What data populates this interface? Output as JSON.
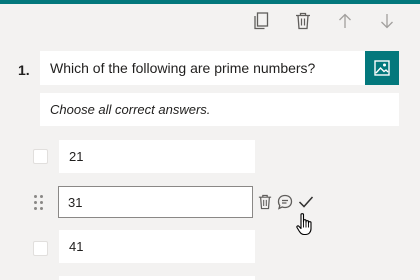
{
  "colors": {
    "accent": "#03787c",
    "icon": "#605e5c",
    "icon_disabled": "#a19f9d"
  },
  "toolbar": {
    "icons": [
      "copy-icon",
      "delete-icon",
      "move-up-icon",
      "move-down-icon"
    ]
  },
  "question": {
    "number": "1.",
    "title": "Which of the following are prime numbers?",
    "subtitle": "Choose all correct answers.",
    "image_icon": "image-icon"
  },
  "options": [
    {
      "value": "21",
      "checked": false
    },
    {
      "value": "31",
      "checked": false,
      "active": true
    },
    {
      "value": "41",
      "checked": false
    }
  ],
  "option_actions": [
    "delete-icon",
    "comment-icon",
    "check-icon"
  ],
  "cursor": "hand-pointer-icon"
}
